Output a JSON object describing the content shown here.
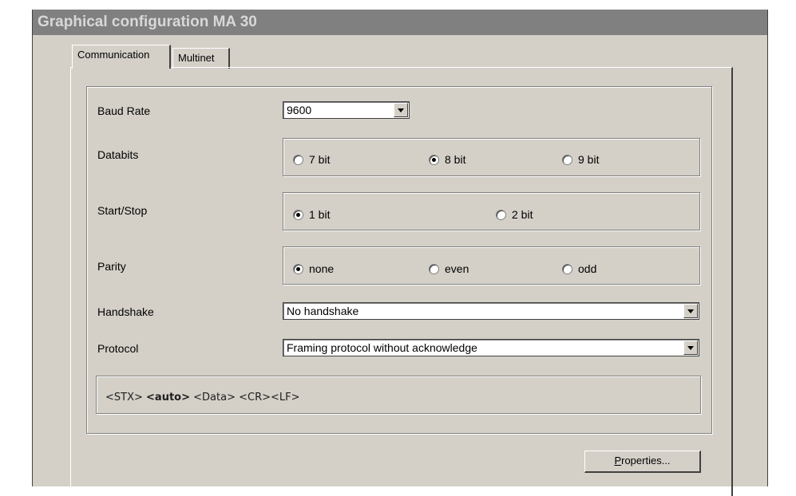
{
  "window": {
    "title": "Graphical configuration MA 30"
  },
  "tabs": [
    {
      "label": "Communication",
      "active": true
    },
    {
      "label": "Multinet",
      "active": false
    }
  ],
  "fields": {
    "baud_rate": {
      "label": "Baud Rate",
      "value": "9600"
    },
    "databits": {
      "label": "Databits",
      "options": [
        "7 bit",
        "8 bit",
        "9 bit"
      ],
      "selected": "8 bit"
    },
    "start_stop": {
      "label": "Start/Stop",
      "options": [
        "1 bit",
        "2 bit"
      ],
      "selected": "1 bit"
    },
    "parity": {
      "label": "Parity",
      "options": [
        "none",
        "even",
        "odd"
      ],
      "selected": "none"
    },
    "handshake": {
      "label": "Handshake",
      "value": "No handshake"
    },
    "protocol": {
      "label": "Protocol",
      "value": "Framing protocol without acknowledge"
    }
  },
  "protocol_preview": {
    "stx": "<STX>",
    "auto": "<auto>",
    "data": "<Data>",
    "crlf": "<CR><LF>"
  },
  "buttons": {
    "properties": {
      "mnemonic": "P",
      "rest": "roperties..."
    }
  }
}
